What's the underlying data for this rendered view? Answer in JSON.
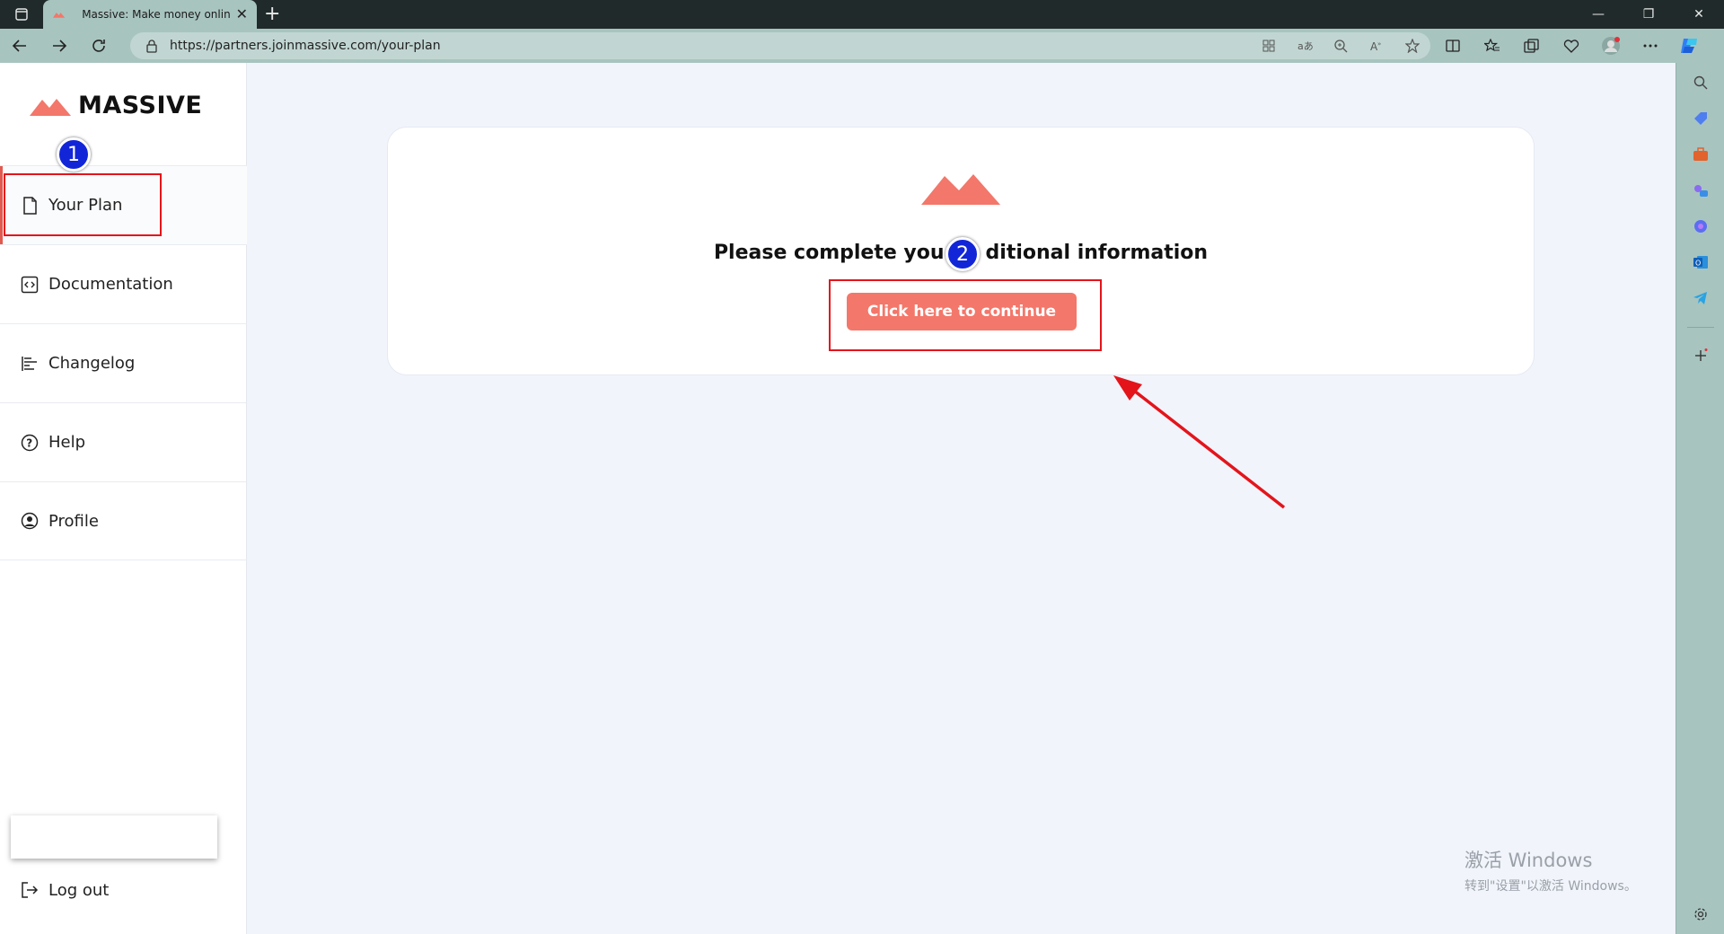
{
  "browser": {
    "tab_title": "Massive: Make money online with",
    "url": "https://partners.joinmassive.com/your-plan"
  },
  "app": {
    "logo_text": "MASSIVE",
    "brand_color": "#f3776a"
  },
  "nav": {
    "items": [
      {
        "label": "Your Plan",
        "icon": "document-icon",
        "active": true
      },
      {
        "label": "Documentation",
        "icon": "code-icon",
        "active": false
      },
      {
        "label": "Changelog",
        "icon": "changelog-icon",
        "active": false
      },
      {
        "label": "Help",
        "icon": "help-icon",
        "active": false
      },
      {
        "label": "Profile",
        "icon": "profile-icon",
        "active": false
      }
    ],
    "logout_label": "Log out"
  },
  "main": {
    "heading_left": "Please complete you",
    "heading_right": "ditional information",
    "cta_label": "Click here to continue"
  },
  "annotations": {
    "badge_1": "1",
    "badge_2": "2",
    "highlight_color": "#e4141b",
    "badge_color": "#1226d8"
  },
  "watermark": {
    "line1": "激活 Windows",
    "line2": "转到\"设置\"以激活 Windows。"
  }
}
